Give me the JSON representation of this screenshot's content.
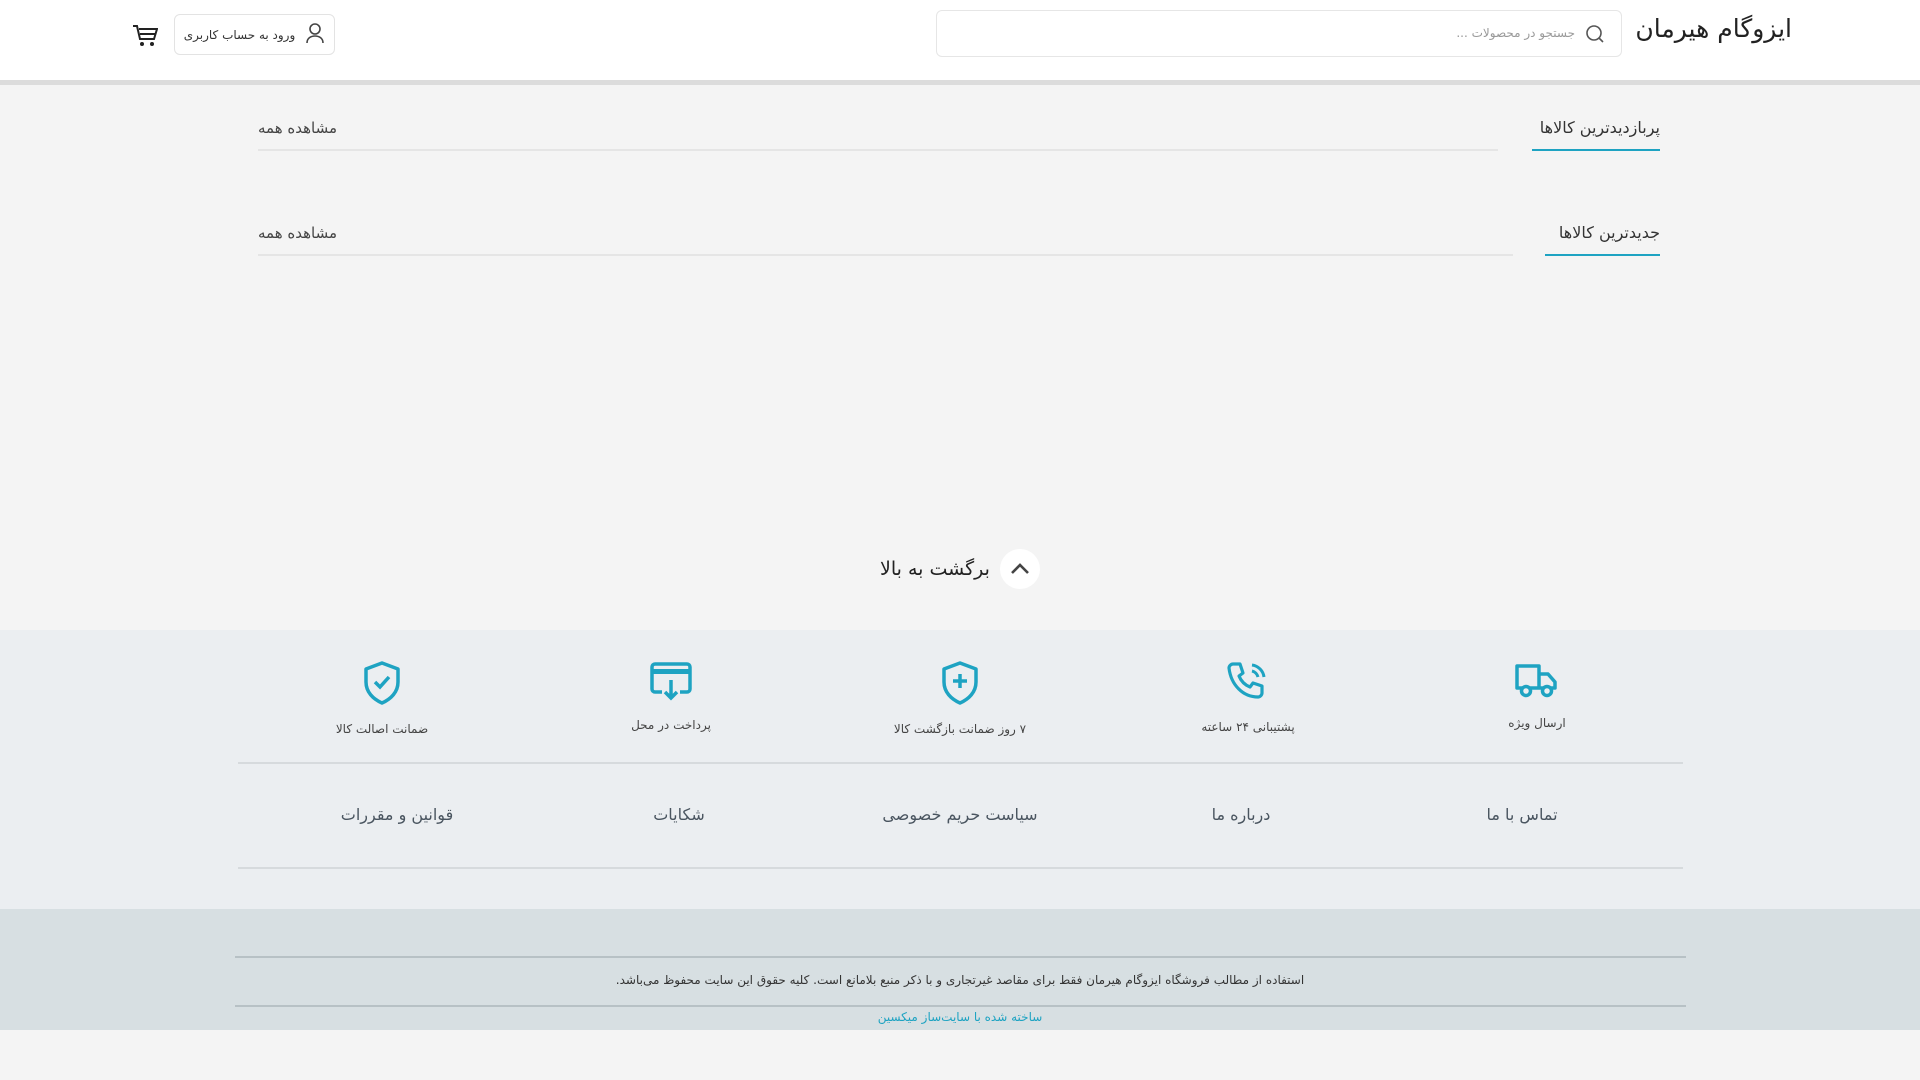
{
  "header": {
    "logo": "ایزوگام هیرمان",
    "search_placeholder": "جستجو در محصولات ...",
    "login_label": "ورود به حساب کاربری"
  },
  "sections": [
    {
      "title": "پربازدیدترین کالاها",
      "view_all": "مشاهده همه"
    },
    {
      "title": "جدیدترین کالاها",
      "view_all": "مشاهده همه"
    }
  ],
  "back_to_top": "برگشت به بالا",
  "features": [
    {
      "icon": "truck-icon",
      "label": "ارسال ویژه"
    },
    {
      "icon": "phone-icon",
      "label": "پشتیبانی ۲۴ ساعته"
    },
    {
      "icon": "shield-plus-icon",
      "label": "۷ روز ضمانت بازگشت کالا"
    },
    {
      "icon": "card-download-icon",
      "label": "پرداخت در محل"
    },
    {
      "icon": "shield-check-icon",
      "label": "ضمانت اصالت کالا"
    }
  ],
  "links": [
    "تماس با ما",
    "درباره ما",
    "سیاست حریم خصوصی",
    "شکایات",
    "قوانین و مقررات"
  ],
  "copyright": "استفاده از مطالب فروشگاه ایزوگام هیرمان فقط برای مقاصد غیرتجاری و با ذکر منبع بلامانع است. کلیه حقوق این سایت محفوظ می‌باشد.",
  "made_with": "ساخته شده با سایت‌ساز میکسین",
  "colors": {
    "accent": "#1ea3c2"
  }
}
